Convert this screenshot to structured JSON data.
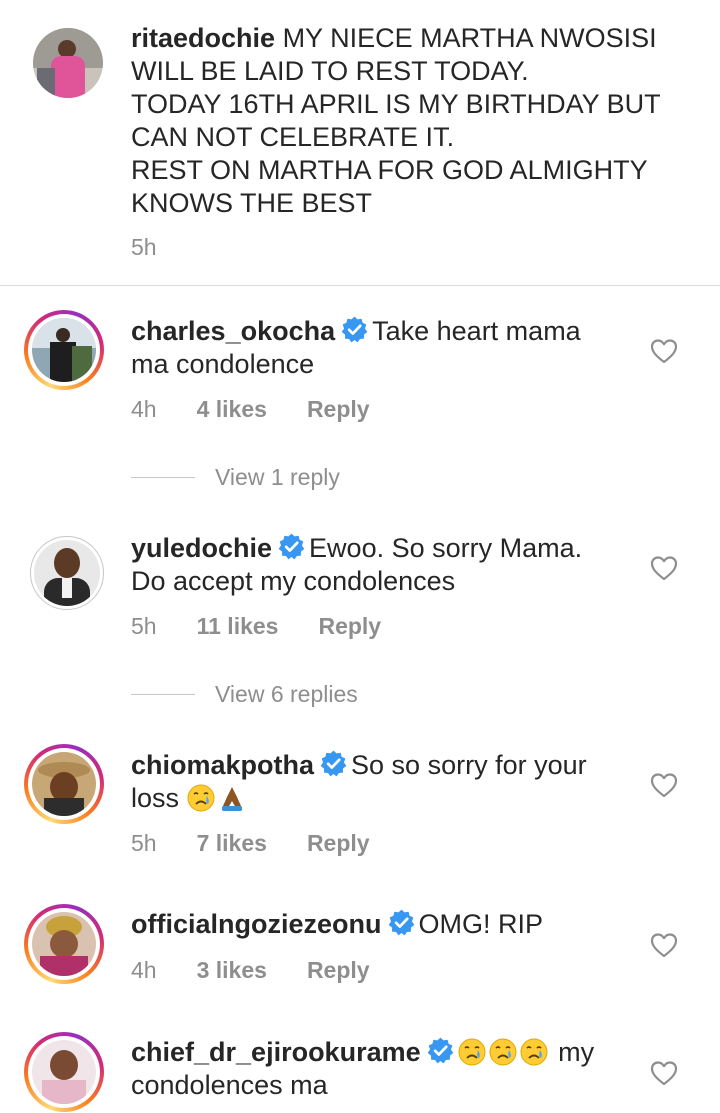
{
  "caption": {
    "username": "ritaedochie",
    "lines": [
      "MY NIECE MARTHA NWOSISI",
      "WILL BE LAID TO REST TODAY.",
      "TODAY 16TH APRIL IS MY BIRTHDAY BUT",
      "CAN NOT CELEBRATE IT.",
      "REST ON MARTHA FOR GOD ALMIGHTY",
      "KNOWS THE BEST"
    ],
    "time": "5h"
  },
  "comments": [
    {
      "username": "charles_okocha",
      "line1": "Take heart mama",
      "line2": "ma condolence",
      "time": "4h",
      "likes": "4 likes",
      "reply": "Reply",
      "view_replies": "View 1 reply"
    },
    {
      "username": "yuledochie",
      "line1": "Ewoo. So sorry Mama.",
      "line2": "Do accept my condolences",
      "time": "5h",
      "likes": "11 likes",
      "reply": "Reply",
      "view_replies": "View 6 replies"
    },
    {
      "username": "chiomakpotha",
      "line1": "So so sorry for your",
      "line2": "loss",
      "line2_emoji": [
        "crying-face",
        "folded-hands"
      ],
      "time": "5h",
      "likes": "7 likes",
      "reply": "Reply"
    },
    {
      "username": "officialngoziezeonu",
      "line1": "OMG! RIP",
      "time": "4h",
      "likes": "3 likes",
      "reply": "Reply"
    },
    {
      "username": "chief_dr_ejirookurame",
      "line1_emoji": [
        "crying-face",
        "crying-face",
        "crying-face"
      ],
      "line1": "my",
      "line2": "condolences ma"
    }
  ],
  "colors": {
    "text": "#262626",
    "muted": "#8e8e8e",
    "verified": "#3897f0",
    "divider": "#dbdbdb"
  }
}
